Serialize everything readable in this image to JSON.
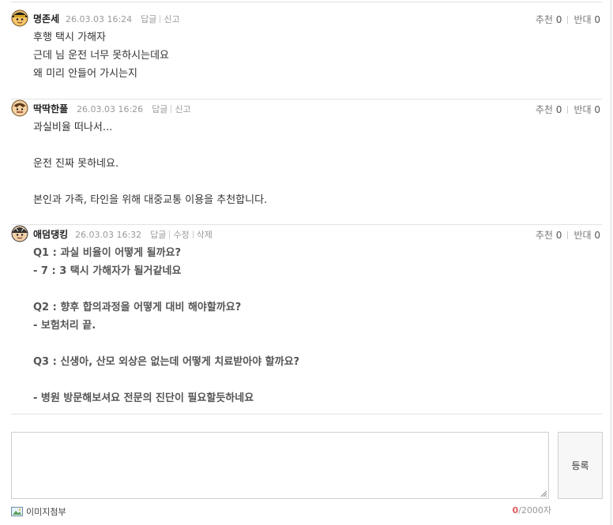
{
  "comments": [
    {
      "nickname": "명존세",
      "datetime": "26.03.03 16:24",
      "actions": [
        "답글",
        "신고"
      ],
      "recommend_label": "추천",
      "recommend_count": "0",
      "oppose_label": "반대",
      "oppose_count": "0",
      "lines": [
        "후행 택시 가해자",
        "근데 님 운전 너무 못하시는데요",
        "왜 미리 안들어 가시는지"
      ]
    },
    {
      "nickname": "딱딱한풀",
      "datetime": "26.03.03 16:26",
      "actions": [
        "답글",
        "신고"
      ],
      "recommend_label": "추천",
      "recommend_count": "0",
      "oppose_label": "반대",
      "oppose_count": "0",
      "lines": [
        "과실비율 떠나서...",
        "",
        "운전 진짜 못하네요.",
        "",
        "본인과 가족, 타인을 위해 대중교통 이용을 추천합니다."
      ]
    },
    {
      "nickname": "애덤댕킹",
      "datetime": "26.03.03 16:32",
      "actions": [
        "답글",
        "수정",
        "삭제"
      ],
      "recommend_label": "추천",
      "recommend_count": "0",
      "oppose_label": "반대",
      "oppose_count": "0",
      "lines": [
        "Q1 : 과실 비율이 어떻게 될까요?",
        "- 7 : 3 택시 가해자가 될거같네요",
        "",
        "Q2 : 향후 합의과정을 어떻게 대비 해야할까요?",
        "- 보험처리 끝.",
        "",
        "Q3 : 신생아, 산모 외상은 없는데 어떻게 치료받아야 할까요?",
        "",
        "- 병원 방문해보셔요 전문의 진단이 필요할듯하네요"
      ]
    }
  ],
  "form": {
    "textarea_value": "",
    "submit_label": "등록",
    "attach_label": "이미지첨부",
    "counter_current": "0",
    "counter_max": "/2000자"
  },
  "icons": {
    "avatar": "cartoon-avatar-icon",
    "attach": "image-icon"
  },
  "colors": {
    "counter_current": "#e05a5a",
    "meta": "#999999",
    "border": "#e2e2e2"
  }
}
